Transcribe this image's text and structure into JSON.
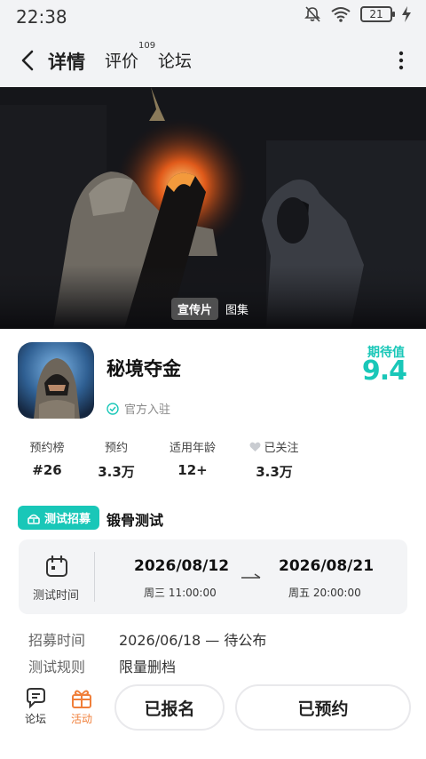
{
  "status_bar": {
    "time": "22:38",
    "battery": "21"
  },
  "nav": {
    "tabs": [
      {
        "label": "详情",
        "active": true
      },
      {
        "label": "评价",
        "count": "109"
      },
      {
        "label": "论坛"
      }
    ]
  },
  "media": {
    "tabs": [
      "宣传片",
      "图集"
    ],
    "active": "宣传片"
  },
  "game": {
    "title": "秘境夺金",
    "official": "官方入驻",
    "expect_label": "期待值",
    "expect_score": "9.4"
  },
  "stats": [
    {
      "label": "预约榜",
      "value": "#26"
    },
    {
      "label": "预约",
      "value": "3.3万"
    },
    {
      "label": "适用年龄",
      "value": "12+"
    },
    {
      "label": "已关注",
      "value": "3.3万"
    }
  ],
  "recruit": {
    "badge": "测试招募",
    "name": "锻骨测试",
    "time_label": "测试时间",
    "start_date": "2026/08/12",
    "start_weekday": "周三  11:00:00",
    "end_date": "2026/08/21",
    "end_weekday": "周五  20:00:00",
    "rows": [
      {
        "key": "招募时间",
        "value": "2026/06/18 — 待公布"
      },
      {
        "key": "测试规则",
        "value": "限量删档"
      }
    ]
  },
  "bottom": {
    "forum": "论坛",
    "activity": "活动",
    "enrolled": "已报名",
    "reserved": "已预约"
  },
  "colors": {
    "accent": "#19c7b8",
    "activity": "#f07f3a"
  }
}
